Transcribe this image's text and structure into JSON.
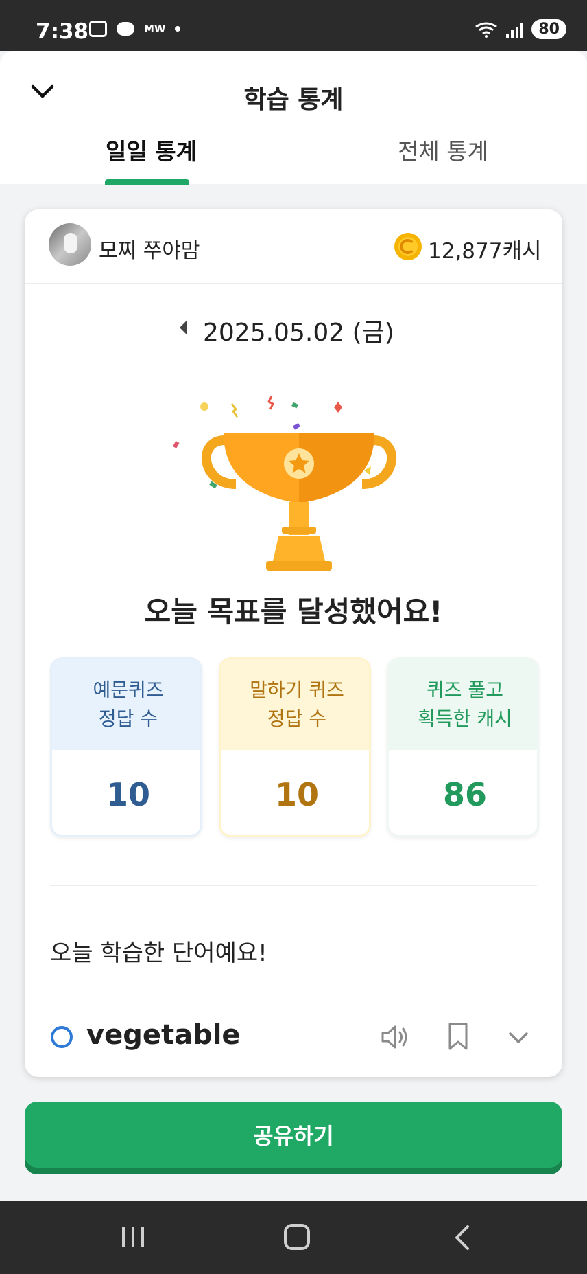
{
  "status_bar": {
    "time": "7:38",
    "mw_label": "MW",
    "battery": "80"
  },
  "header": {
    "title": "학습 통계",
    "tabs": [
      {
        "label": "일일 통계",
        "active": true
      },
      {
        "label": "전체 통계",
        "active": false
      }
    ]
  },
  "profile": {
    "nickname": "모찌 쭈야맘",
    "cash": "12,877캐시"
  },
  "date": "2025.05.02 (금)",
  "goal_message": "오늘 목표를 달성했어요!",
  "stats": [
    {
      "label_line1": "예문퀴즈",
      "label_line2": "정답 수",
      "value": "10",
      "color": "#2f5d91"
    },
    {
      "label_line1": "말하기 퀴즈",
      "label_line2": "정답 수",
      "value": "10",
      "color": "#b07410"
    },
    {
      "label_line1": "퀴즈 풀고",
      "label_line2": "획득한 캐시",
      "value": "86",
      "color": "#229a5d"
    }
  ],
  "words_section": {
    "title": "오늘 학습한 단어예요!",
    "words": [
      {
        "word": "vegetable"
      }
    ]
  },
  "share_button": "공유하기",
  "colors": {
    "accent": "#20a865",
    "word_circle": "#2e7ad6"
  },
  "icons": [
    "chevron-down-icon",
    "coin-icon",
    "trophy-icon",
    "speaker-icon",
    "bookmark-icon",
    "expand-icon",
    "recents-icon",
    "home-icon",
    "back-icon"
  ]
}
